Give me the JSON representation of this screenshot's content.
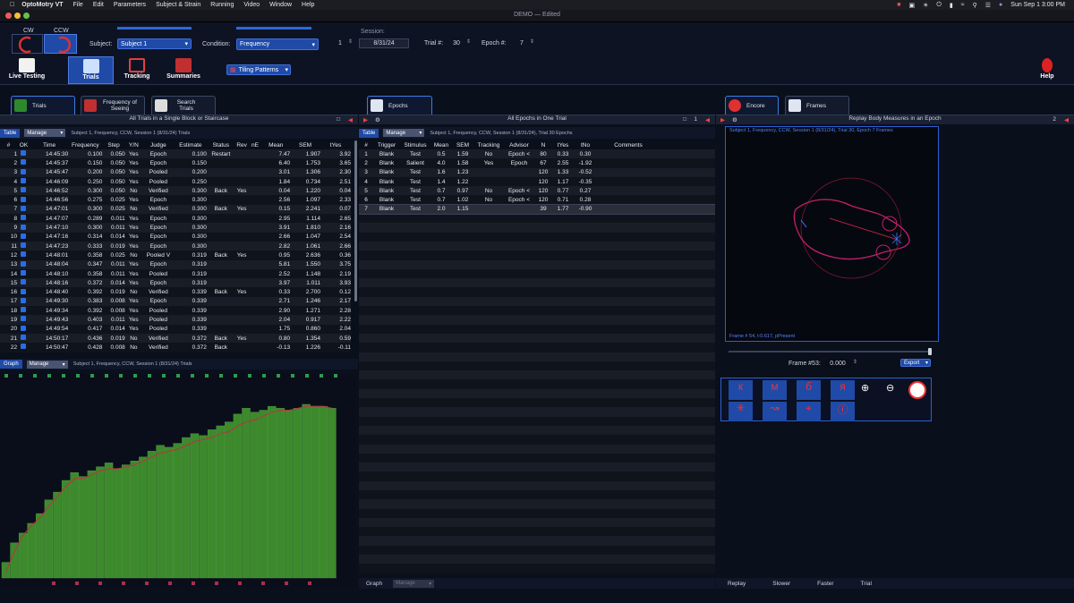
{
  "menubar": {
    "app": "OptoMotry VT",
    "items": [
      "File",
      "Edit",
      "Parameters",
      "Subject & Strain",
      "Running",
      "Video",
      "Window",
      "Help"
    ],
    "clock": "Sun Sep 1  3:00 PM"
  },
  "window": {
    "title": "DEMO — Edited"
  },
  "top": {
    "cw_label": "CW",
    "ccw_label": "CCW",
    "subject_label": "Subject:",
    "subject_value": "Subject 1",
    "condition_label": "Condition:",
    "condition_value": "Frequency",
    "session_label": "Session:",
    "session_num": "1",
    "session_date": "8/31/24",
    "trial_label": "Trial #:",
    "trial_value": "30",
    "epoch_label": "Epoch #:",
    "epoch_value": "7"
  },
  "toolbar": {
    "live": "Live Testing",
    "trials": "Trials",
    "tracking": "Tracking",
    "summaries": "Summaries",
    "tiling": "Tiling Patterns",
    "help": "Help"
  },
  "left": {
    "tabs": [
      "Trials",
      "Frequency of Seeing",
      "Search Trials"
    ],
    "header": "All Trials in a Single Block or Staircase",
    "table_btn": "Table",
    "manage_btn": "Manage",
    "subinfo": "Subject 1, Frequency, CCW, Session 1 (8/31/24) Trials",
    "columns": [
      "#",
      "OK",
      "Time",
      "Frequency",
      "Step",
      "Y/N",
      "Judge",
      "Estimate",
      "Status",
      "Rev",
      "nE",
      "Mean",
      "SEM",
      "tYes"
    ],
    "rows": [
      [
        "1",
        "14:45:30",
        "0.100",
        "0.050",
        "Yes",
        "Epoch",
        "0.100",
        "Restart",
        "",
        "",
        "7.47",
        "1.907",
        "3.92"
      ],
      [
        "2",
        "14:45:37",
        "0.150",
        "0.050",
        "Yes",
        "Epoch",
        "0.150",
        "",
        "",
        "",
        "6.40",
        "1.753",
        "3.65"
      ],
      [
        "3",
        "14:45:47",
        "0.200",
        "0.050",
        "Yes",
        "Pooled",
        "0.200",
        "",
        "",
        "",
        "3.01",
        "1.306",
        "2.30"
      ],
      [
        "4",
        "14:46:09",
        "0.250",
        "0.050",
        "Yes",
        "Pooled",
        "0.250",
        "",
        "",
        "",
        "1.84",
        "0.734",
        "2.51"
      ],
      [
        "5",
        "14:46:52",
        "0.300",
        "0.050",
        "No",
        "Verified",
        "0.300",
        "Back",
        "Yes",
        "",
        "0.04",
        "1.220",
        "0.04"
      ],
      [
        "6",
        "14:46:56",
        "0.275",
        "0.025",
        "Yes",
        "Epoch",
        "0.300",
        "",
        "",
        "",
        "2.56",
        "1.097",
        "2.33"
      ],
      [
        "7",
        "14:47:01",
        "0.300",
        "0.025",
        "No",
        "Verified",
        "0.300",
        "Back",
        "Yes",
        "",
        "0.15",
        "2.241",
        "0.07"
      ],
      [
        "8",
        "14:47:07",
        "0.289",
        "0.011",
        "Yes",
        "Epoch",
        "0.300",
        "",
        "",
        "",
        "2.95",
        "1.114",
        "2.65"
      ],
      [
        "9",
        "14:47:10",
        "0.300",
        "0.011",
        "Yes",
        "Epoch",
        "0.300",
        "",
        "",
        "",
        "3.91",
        "1.810",
        "2.16"
      ],
      [
        "10",
        "14:47:16",
        "0.314",
        "0.014",
        "Yes",
        "Epoch",
        "0.300",
        "",
        "",
        "",
        "2.66",
        "1.047",
        "2.54"
      ],
      [
        "11",
        "14:47:23",
        "0.333",
        "0.019",
        "Yes",
        "Epoch",
        "0.300",
        "",
        "",
        "",
        "2.82",
        "1.061",
        "2.66"
      ],
      [
        "12",
        "14:48:01",
        "0.358",
        "0.025",
        "No",
        "Pooled V",
        "0.319",
        "Back",
        "Yes",
        "",
        "0.95",
        "2.636",
        "0.36"
      ],
      [
        "13",
        "14:48:04",
        "0.347",
        "0.011",
        "Yes",
        "Epoch",
        "0.319",
        "",
        "",
        "",
        "5.81",
        "1.550",
        "3.75"
      ],
      [
        "14",
        "14:48:10",
        "0.358",
        "0.011",
        "Yes",
        "Pooled",
        "0.319",
        "",
        "",
        "",
        "2.52",
        "1.148",
        "2.19"
      ],
      [
        "15",
        "14:48:16",
        "0.372",
        "0.014",
        "Yes",
        "Epoch",
        "0.319",
        "",
        "",
        "",
        "3.97",
        "1.011",
        "3.93"
      ],
      [
        "16",
        "14:48:40",
        "0.392",
        "0.019",
        "No",
        "Verified",
        "0.339",
        "Back",
        "Yes",
        "",
        "0.33",
        "2.700",
        "0.12"
      ],
      [
        "17",
        "14:49:30",
        "0.383",
        "0.008",
        "Yes",
        "Epoch",
        "0.339",
        "",
        "",
        "",
        "2.71",
        "1.246",
        "2.17"
      ],
      [
        "18",
        "14:49:34",
        "0.392",
        "0.008",
        "Yes",
        "Pooled",
        "0.339",
        "",
        "",
        "",
        "2.90",
        "1.271",
        "2.28"
      ],
      [
        "19",
        "14:49:43",
        "0.403",
        "0.011",
        "Yes",
        "Pooled",
        "0.339",
        "",
        "",
        "",
        "2.04",
        "0.917",
        "2.22"
      ],
      [
        "20",
        "14:49:54",
        "0.417",
        "0.014",
        "Yes",
        "Pooled",
        "0.339",
        "",
        "",
        "",
        "1.75",
        "0.860",
        "2.04"
      ],
      [
        "21",
        "14:50:17",
        "0.436",
        "0.019",
        "No",
        "Verified",
        "0.372",
        "Back",
        "Yes",
        "",
        "0.80",
        "1.354",
        "0.59"
      ],
      [
        "22",
        "14:50:47",
        "0.428",
        "0.008",
        "No",
        "Verified",
        "0.372",
        "Back",
        "",
        "",
        "-0.13",
        "1.226",
        "-0.11"
      ]
    ],
    "graph_btn": "Graph",
    "graph_info": "Subject 1, Frequency, CCW, Session 1 (8/31/24) Trials"
  },
  "chart_data": {
    "type": "bar",
    "values": [
      8,
      18,
      23,
      28,
      33,
      40,
      44,
      50,
      54,
      52,
      55,
      57,
      59,
      56,
      58,
      60,
      62,
      65,
      68,
      67,
      69,
      72,
      74,
      73,
      76,
      78,
      80,
      84,
      87,
      85,
      86,
      88,
      87,
      86,
      87,
      89,
      88,
      88,
      87
    ],
    "line": [
      3,
      14,
      22,
      27,
      31,
      37,
      42,
      47,
      51,
      51,
      53,
      55,
      56,
      56,
      57,
      58,
      60,
      62,
      64,
      65,
      66,
      68,
      70,
      71,
      72,
      74,
      75,
      78,
      80,
      81,
      83,
      85,
      86,
      86,
      87,
      88,
      88,
      88,
      87
    ],
    "ylim": [
      0,
      100
    ],
    "bar_color": "#3c8a2c",
    "line_color": "#c03040"
  },
  "middle": {
    "tab": "Epochs",
    "header": "All Epochs in One Trial",
    "count": "1",
    "table_btn": "Table",
    "manage_btn": "Manage",
    "subinfo": "Subject 1, Frequency, CCW, Session 1 (8/31/24), Trial 30 Epochs",
    "columns": [
      "#",
      "Trigger",
      "Stimulus",
      "Mean",
      "SEM",
      "Tracking",
      "Advisor",
      "N",
      "tYes",
      "tNo",
      "Comments"
    ],
    "rows": [
      [
        "1",
        "Blank",
        "Test",
        "0.5",
        "1.59",
        "No",
        "Epoch <",
        "80",
        "0.33",
        "0.30",
        ""
      ],
      [
        "2",
        "Blank",
        "Salient",
        "4.0",
        "1.58",
        "Yes",
        "Epoch",
        "67",
        "2.55",
        "-1.92",
        ""
      ],
      [
        "3",
        "Blank",
        "Test",
        "1.6",
        "1.23",
        "",
        "",
        "120",
        "1.33",
        "-0.52",
        ""
      ],
      [
        "4",
        "Blank",
        "Test",
        "1.4",
        "1.22",
        "",
        "",
        "120",
        "1.17",
        "-0.35",
        ""
      ],
      [
        "5",
        "Blank",
        "Test",
        "0.7",
        "0.97",
        "No",
        "Epoch <",
        "120",
        "0.77",
        "0.27",
        ""
      ],
      [
        "6",
        "Blank",
        "Test",
        "0.7",
        "1.02",
        "No",
        "Epoch <",
        "120",
        "0.71",
        "0.28",
        ""
      ],
      [
        "7",
        "Blank",
        "Test",
        "2.0",
        "1.15",
        "",
        "",
        "39",
        "1.77",
        "-0.90",
        ""
      ]
    ],
    "graph_btn": "Graph",
    "manage2": "Manage"
  },
  "right": {
    "tabs": [
      "Encore",
      "Frames"
    ],
    "header": "Replay Body Measures in an Epoch",
    "count": "2",
    "video_title": "Subject 1, Frequency, CCW, Session 1 (8/31/24), Trial 30, Epoch 7 Frames",
    "frame_status": "Frame # 54, t:0.617, pPresent",
    "frame_label": "Frame #53:",
    "frame_value": "0.000",
    "export_btn": "Export",
    "replay": "Replay",
    "slower": "Slower",
    "faster": "Faster",
    "trial": "Trial"
  }
}
